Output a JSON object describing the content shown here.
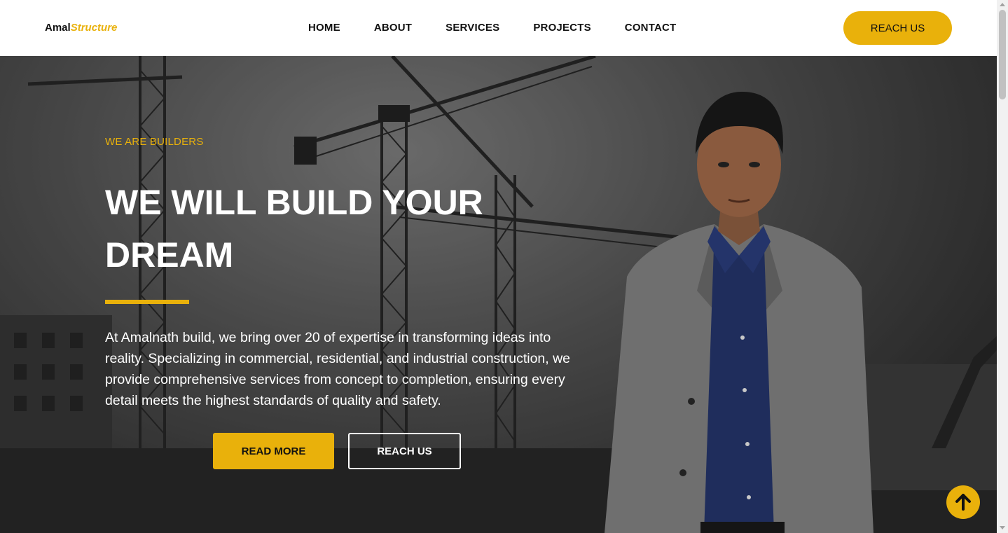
{
  "header": {
    "logo_main": "Amal",
    "logo_accent": "Structure",
    "nav": [
      "HOME",
      "ABOUT",
      "SERVICES",
      "PROJECTS",
      "CONTACT"
    ],
    "cta": "REACH US"
  },
  "hero": {
    "eyebrow": "WE ARE BUILDERS",
    "headline": "WE WILL BUILD YOUR DREAM",
    "body": "At Amalnath build, we bring over 20 of expertise in transforming ideas into reality. Specializing in commercial, residential, and industrial construction, we provide comprehensive services from concept to completion, ensuring every detail meets the highest standards of quality and safety.",
    "primary_button": "READ MORE",
    "secondary_button": "REACH US"
  },
  "colors": {
    "accent": "#e9b10b",
    "text_dark": "#111111",
    "text_light": "#ffffff"
  },
  "icons": {
    "scroll_to_top": "arrow-up-icon"
  }
}
